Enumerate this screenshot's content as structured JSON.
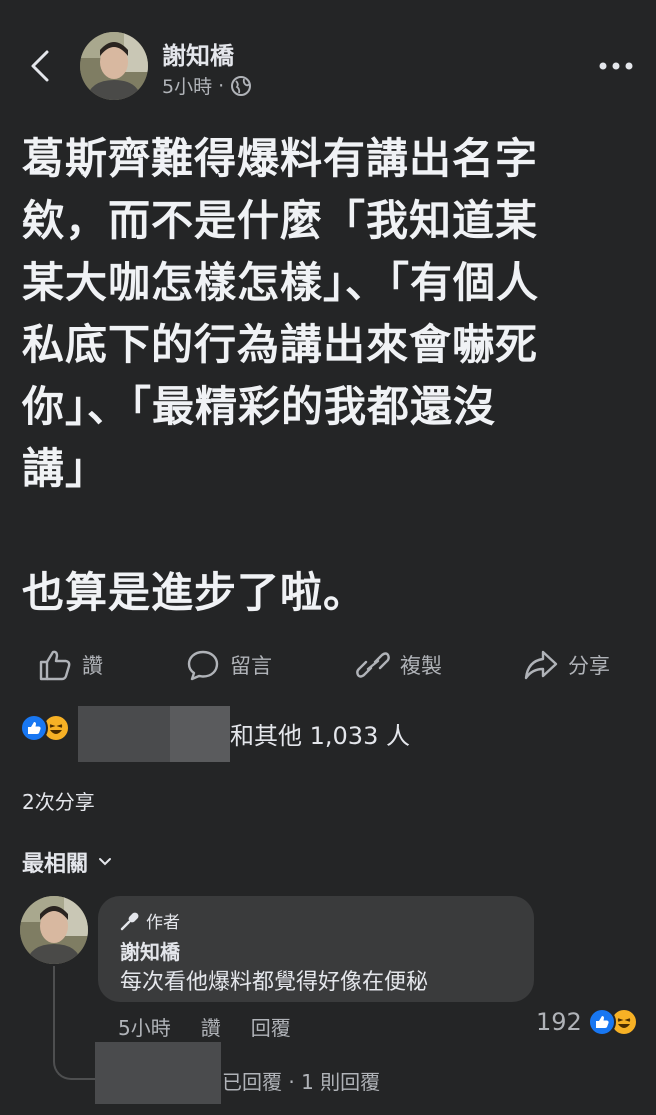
{
  "header": {
    "author": "謝知橋",
    "time": "5小時",
    "separator": "·"
  },
  "post": {
    "lines": [
      "葛斯齊難得爆料有講出名字",
      "欸，而不是什麼「我知道某",
      "某大咖怎樣怎樣」、「有個人",
      "私底下的行為講出來會嚇死",
      "你」、「最精彩的我都還沒",
      "講」"
    ],
    "closing": "也算是進步了啦。"
  },
  "actions": {
    "like": "讚",
    "comment": "留言",
    "copy": "複製",
    "share": "分享"
  },
  "reactions": {
    "others_text": "和其他 1,033 人"
  },
  "shares_text": "2次分享",
  "sort_label": "最相關",
  "comment": {
    "badge": "作者",
    "name": "謝知橋",
    "text": "每次看他爆料都覺得好像在便秘",
    "time": "5小時",
    "like": "讚",
    "reply": "回覆",
    "reaction_count": "192",
    "replies_text": "已回覆 · 1 則回覆"
  },
  "colors": {
    "background": "#242526",
    "bubble": "#3a3b3c",
    "like_blue": "#1877f2",
    "haha_yellow": "#f7b125"
  }
}
